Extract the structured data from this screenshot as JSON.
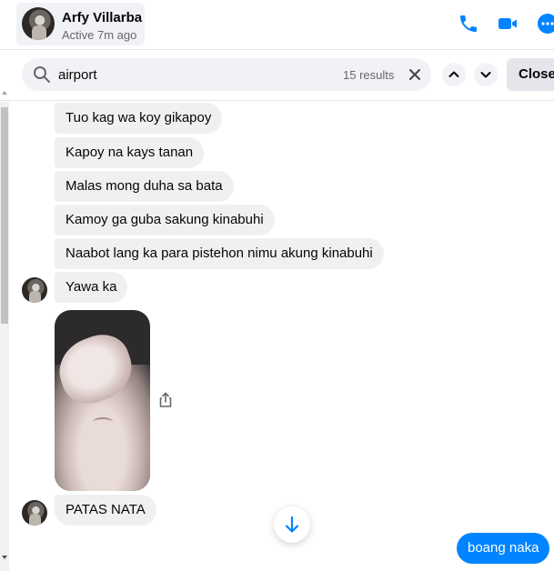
{
  "header": {
    "name": "Arfy Villarba",
    "status": "Active 7m ago"
  },
  "search": {
    "query": "airport",
    "results": "15 results",
    "close_label": "Close"
  },
  "messages": {
    "m1": "Tuo kag wa koy gikapoy",
    "m2": "Kapoy na kays tanan",
    "m3": "Malas mong duha sa bata",
    "m4": "Kamoy ga guba sakung kinabuhi",
    "m5": "Naabot lang ka para pistehon nimu akung kinabuhi",
    "m6": "Yawa ka",
    "m7": "PATAS NATA",
    "sent1": "boang naka"
  },
  "colors": {
    "accent": "#0084ff",
    "incoming_bubble": "#f0f0f0"
  }
}
